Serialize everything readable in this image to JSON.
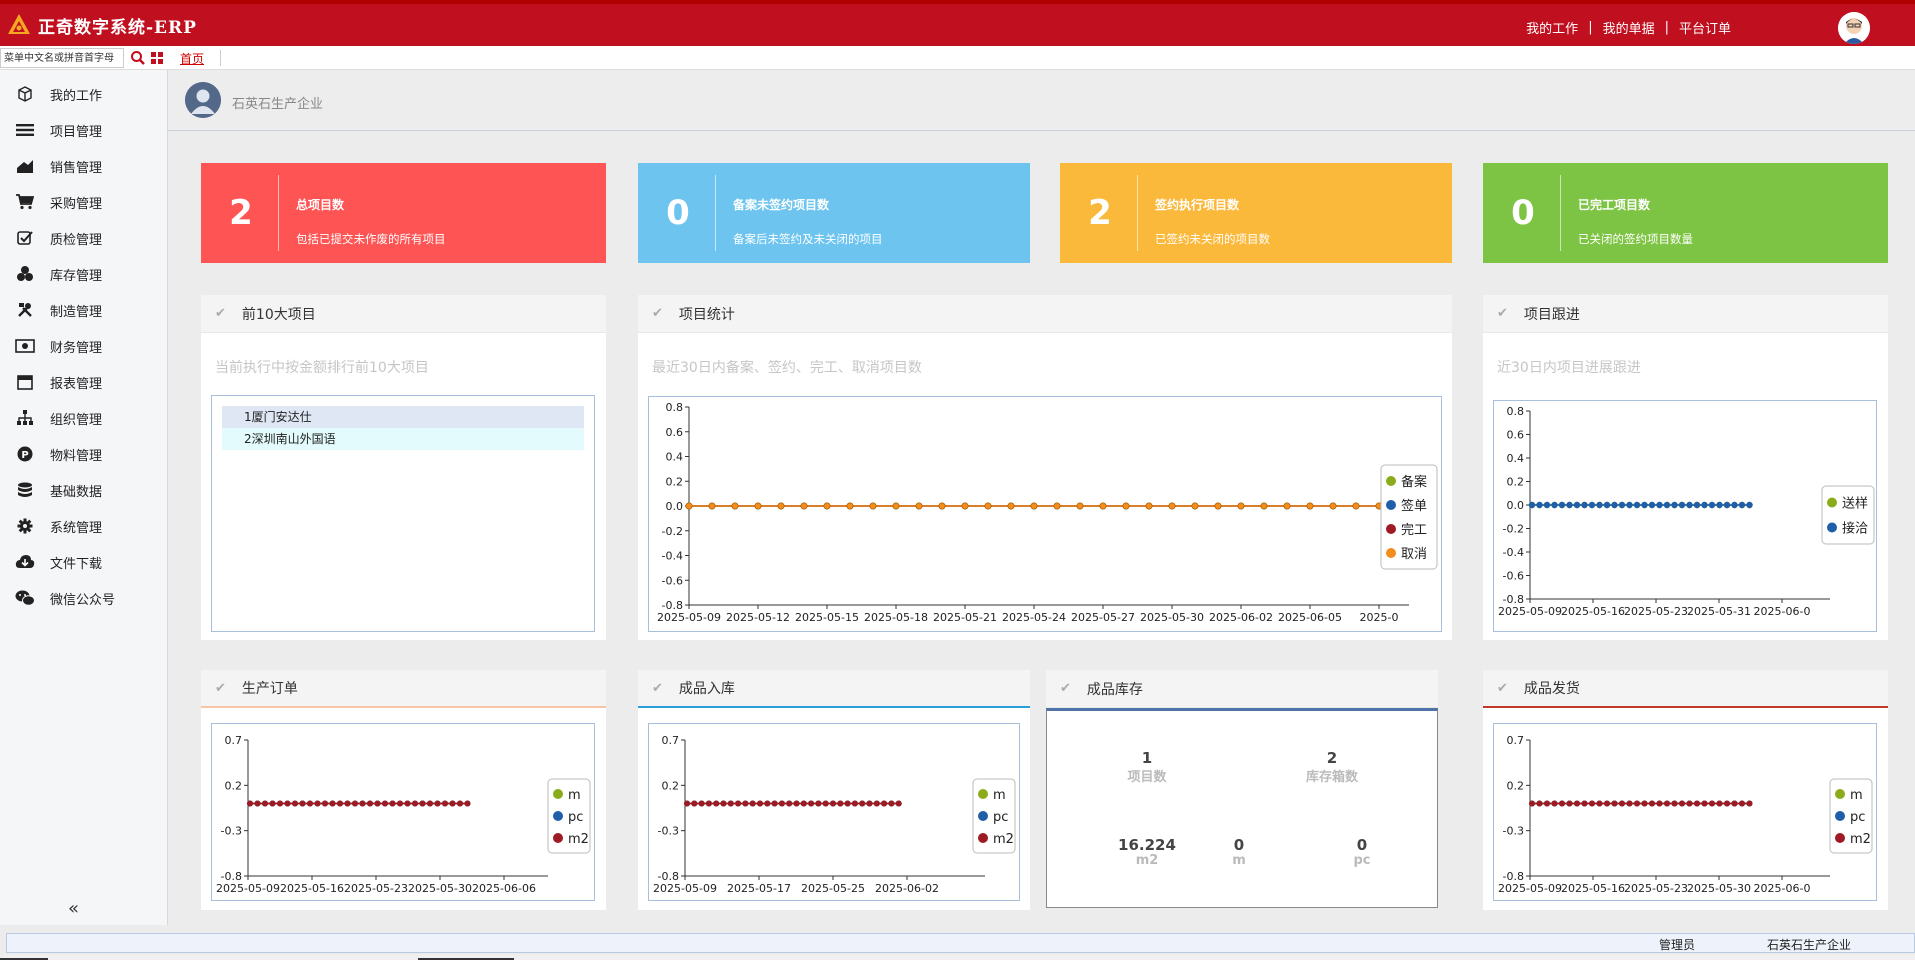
{
  "app": {
    "title": "正奇数字系统-ERP"
  },
  "topnav": {
    "my_work": "我的工作",
    "my_docs": "我的单据",
    "platform_orders": "平台订单",
    "sep": "|"
  },
  "subbar": {
    "search_placeholder": "菜单中文名或拼音首字母",
    "home_tab": "首页"
  },
  "sidebar": {
    "items": [
      {
        "label": "我的工作",
        "icon": "cube-icon"
      },
      {
        "label": "项目管理",
        "icon": "list-icon"
      },
      {
        "label": "销售管理",
        "icon": "chart-icon"
      },
      {
        "label": "采购管理",
        "icon": "cart-icon"
      },
      {
        "label": "质检管理",
        "icon": "check-square-icon"
      },
      {
        "label": "库存管理",
        "icon": "cubes-icon"
      },
      {
        "label": "制造管理",
        "icon": "tools-icon"
      },
      {
        "label": "财务管理",
        "icon": "money-icon"
      },
      {
        "label": "报表管理",
        "icon": "calendar-icon"
      },
      {
        "label": "组织管理",
        "icon": "org-icon"
      },
      {
        "label": "物料管理",
        "icon": "p-circle-icon"
      },
      {
        "label": "基础数据",
        "icon": "database-icon"
      },
      {
        "label": "系统管理",
        "icon": "gear-icon"
      },
      {
        "label": "文件下载",
        "icon": "cloud-download-icon"
      },
      {
        "label": "微信公众号",
        "icon": "wechat-icon"
      }
    ],
    "collapse": "«"
  },
  "company": {
    "name": "石英石生产企业"
  },
  "stats": [
    {
      "value": "2",
      "title": "总项目数",
      "desc": "包括已提交未作废的所有项目",
      "color": "#fe5454"
    },
    {
      "value": "0",
      "title": "备案未签约项目数",
      "desc": "备案后未签约及未关闭的项目",
      "color": "#6cc4ef"
    },
    {
      "value": "2",
      "title": "签约执行项目数",
      "desc": "已签约未关闭的项目数",
      "color": "#fbb93b"
    },
    {
      "value": "0",
      "title": "已完工项目数",
      "desc": "已关闭的签约项目数量",
      "color": "#7ec444"
    }
  ],
  "panels": {
    "top10": {
      "title": "前10大项目",
      "sub": "当前执行中按金额排行前10大项目",
      "rows": [
        "1厦门安达仕",
        "2深圳南山外国语"
      ]
    },
    "stats": {
      "title": "项目统计",
      "sub": "最近30日内备案、签约、完工、取消项目数"
    },
    "follow": {
      "title": "项目跟进",
      "sub": "近30日内项目进展跟进"
    },
    "production": {
      "title": "生产订单"
    },
    "warehousing": {
      "title": "成品入库"
    },
    "inventory": {
      "title": "成品库存",
      "project_count": "1",
      "project_count_label": "项目数",
      "box_count": "2",
      "box_count_label": "库存箱数",
      "m2_value": "16.224",
      "m2_label": "m2",
      "m_value": "0",
      "m_label": "m",
      "pc_value": "0",
      "pc_label": "pc"
    },
    "shipping": {
      "title": "成品发货"
    }
  },
  "footer": {
    "user": "管理员",
    "org": "石英石生产企业"
  },
  "chart_data": [
    {
      "id": "project-stats",
      "type": "line",
      "x": [
        "2025-05-09",
        "2025-05-10",
        "2025-05-11",
        "2025-05-12",
        "2025-05-13",
        "2025-05-14",
        "2025-05-15",
        "2025-05-16",
        "2025-05-17",
        "2025-05-18",
        "2025-05-19",
        "2025-05-20",
        "2025-05-21",
        "2025-05-22",
        "2025-05-23",
        "2025-05-24",
        "2025-05-25",
        "2025-05-26",
        "2025-05-27",
        "2025-05-28",
        "2025-05-29",
        "2025-05-30",
        "2025-05-31",
        "2025-06-01",
        "2025-06-02",
        "2025-06-03",
        "2025-06-04",
        "2025-06-05",
        "2025-06-06",
        "2025-06-07",
        "2025-06-08"
      ],
      "xticks": [
        "2025-05-09",
        "2025-05-12",
        "2025-05-15",
        "2025-05-18",
        "2025-05-21",
        "2025-05-24",
        "2025-05-27",
        "2025-05-30",
        "2025-06-02",
        "2025-06-05",
        "2025-0"
      ],
      "ylim": [
        -0.8,
        0.8
      ],
      "yticks": [
        "0.8",
        "0.6",
        "0.4",
        "0.2",
        "0.0",
        "-0.2",
        "-0.4",
        "-0.6",
        "-0.8"
      ],
      "series": [
        {
          "name": "备案",
          "color": "#8bac1a",
          "values": [
            0,
            0,
            0,
            0,
            0,
            0,
            0,
            0,
            0,
            0,
            0,
            0,
            0,
            0,
            0,
            0,
            0,
            0,
            0,
            0,
            0,
            0,
            0,
            0,
            0,
            0,
            0,
            0,
            0,
            0,
            0
          ]
        },
        {
          "name": "签单",
          "color": "#1f5ea8",
          "values": [
            0,
            0,
            0,
            0,
            0,
            0,
            0,
            0,
            0,
            0,
            0,
            0,
            0,
            0,
            0,
            0,
            0,
            0,
            0,
            0,
            0,
            0,
            0,
            0,
            0,
            0,
            0,
            0,
            0,
            0,
            0
          ]
        },
        {
          "name": "完工",
          "color": "#9e1a25",
          "values": [
            0,
            0,
            0,
            0,
            0,
            0,
            0,
            0,
            0,
            0,
            0,
            0,
            0,
            0,
            0,
            0,
            0,
            0,
            0,
            0,
            0,
            0,
            0,
            0,
            0,
            0,
            0,
            0,
            0,
            0,
            0
          ]
        },
        {
          "name": "取消",
          "color": "#f28c1c",
          "values": [
            0,
            0,
            0,
            0,
            0,
            0,
            0,
            0,
            0,
            0,
            0,
            0,
            0,
            0,
            0,
            0,
            0,
            0,
            0,
            0,
            0,
            0,
            0,
            0,
            0,
            0,
            0,
            0,
            0,
            0,
            0
          ]
        }
      ]
    },
    {
      "id": "project-follow",
      "type": "line",
      "xticks": [
        "2025-05-09",
        "2025-05-16",
        "2025-05-23",
        "2025-05-31",
        "2025-06-0"
      ],
      "ylim": [
        -0.8,
        0.8
      ],
      "yticks": [
        "0.8",
        "0.6",
        "0.4",
        "0.2",
        "0.0",
        "-0.2",
        "-0.4",
        "-0.6",
        "-0.8"
      ],
      "points": 30,
      "series": [
        {
          "name": "送样",
          "color": "#8bac1a",
          "values": [
            0
          ]
        },
        {
          "name": "接洽",
          "color": "#1f5ea8",
          "values": [
            0
          ]
        }
      ]
    },
    {
      "id": "production",
      "type": "line",
      "xticks": [
        "2025-05-09",
        "2025-05-16",
        "2025-05-23",
        "2025-05-30",
        "2025-06-06"
      ],
      "ylim": [
        -0.8,
        0.7
      ],
      "yticks": [
        "0.7",
        "0.2",
        "-0.3",
        "-0.8"
      ],
      "points": 30,
      "series": [
        {
          "name": "m",
          "color": "#8bac1a",
          "values": [
            0
          ]
        },
        {
          "name": "pc",
          "color": "#1f5ea8",
          "values": [
            0
          ]
        },
        {
          "name": "m2",
          "color": "#9e1a25",
          "values": [
            0
          ]
        }
      ]
    },
    {
      "id": "warehousing",
      "type": "line",
      "xticks": [
        "2025-05-09",
        "2025-05-17",
        "2025-05-25",
        "2025-06-02"
      ],
      "ylim": [
        -0.8,
        0.7
      ],
      "yticks": [
        "0.7",
        "0.2",
        "-0.3",
        "-0.8"
      ],
      "points": 30,
      "series": [
        {
          "name": "m",
          "color": "#8bac1a",
          "values": [
            0
          ]
        },
        {
          "name": "pc",
          "color": "#1f5ea8",
          "values": [
            0
          ]
        },
        {
          "name": "m2",
          "color": "#9e1a25",
          "values": [
            0
          ]
        }
      ]
    },
    {
      "id": "shipping",
      "type": "line",
      "xticks": [
        "2025-05-09",
        "2025-05-16",
        "2025-05-23",
        "2025-05-30",
        "2025-06-0"
      ],
      "ylim": [
        -0.8,
        0.7
      ],
      "yticks": [
        "0.7",
        "0.2",
        "-0.3",
        "-0.8"
      ],
      "points": 30,
      "series": [
        {
          "name": "m",
          "color": "#8bac1a",
          "values": [
            0
          ]
        },
        {
          "name": "pc",
          "color": "#1f5ea8",
          "values": [
            0
          ]
        },
        {
          "name": "m2",
          "color": "#9e1a25",
          "values": [
            0
          ]
        }
      ]
    }
  ]
}
